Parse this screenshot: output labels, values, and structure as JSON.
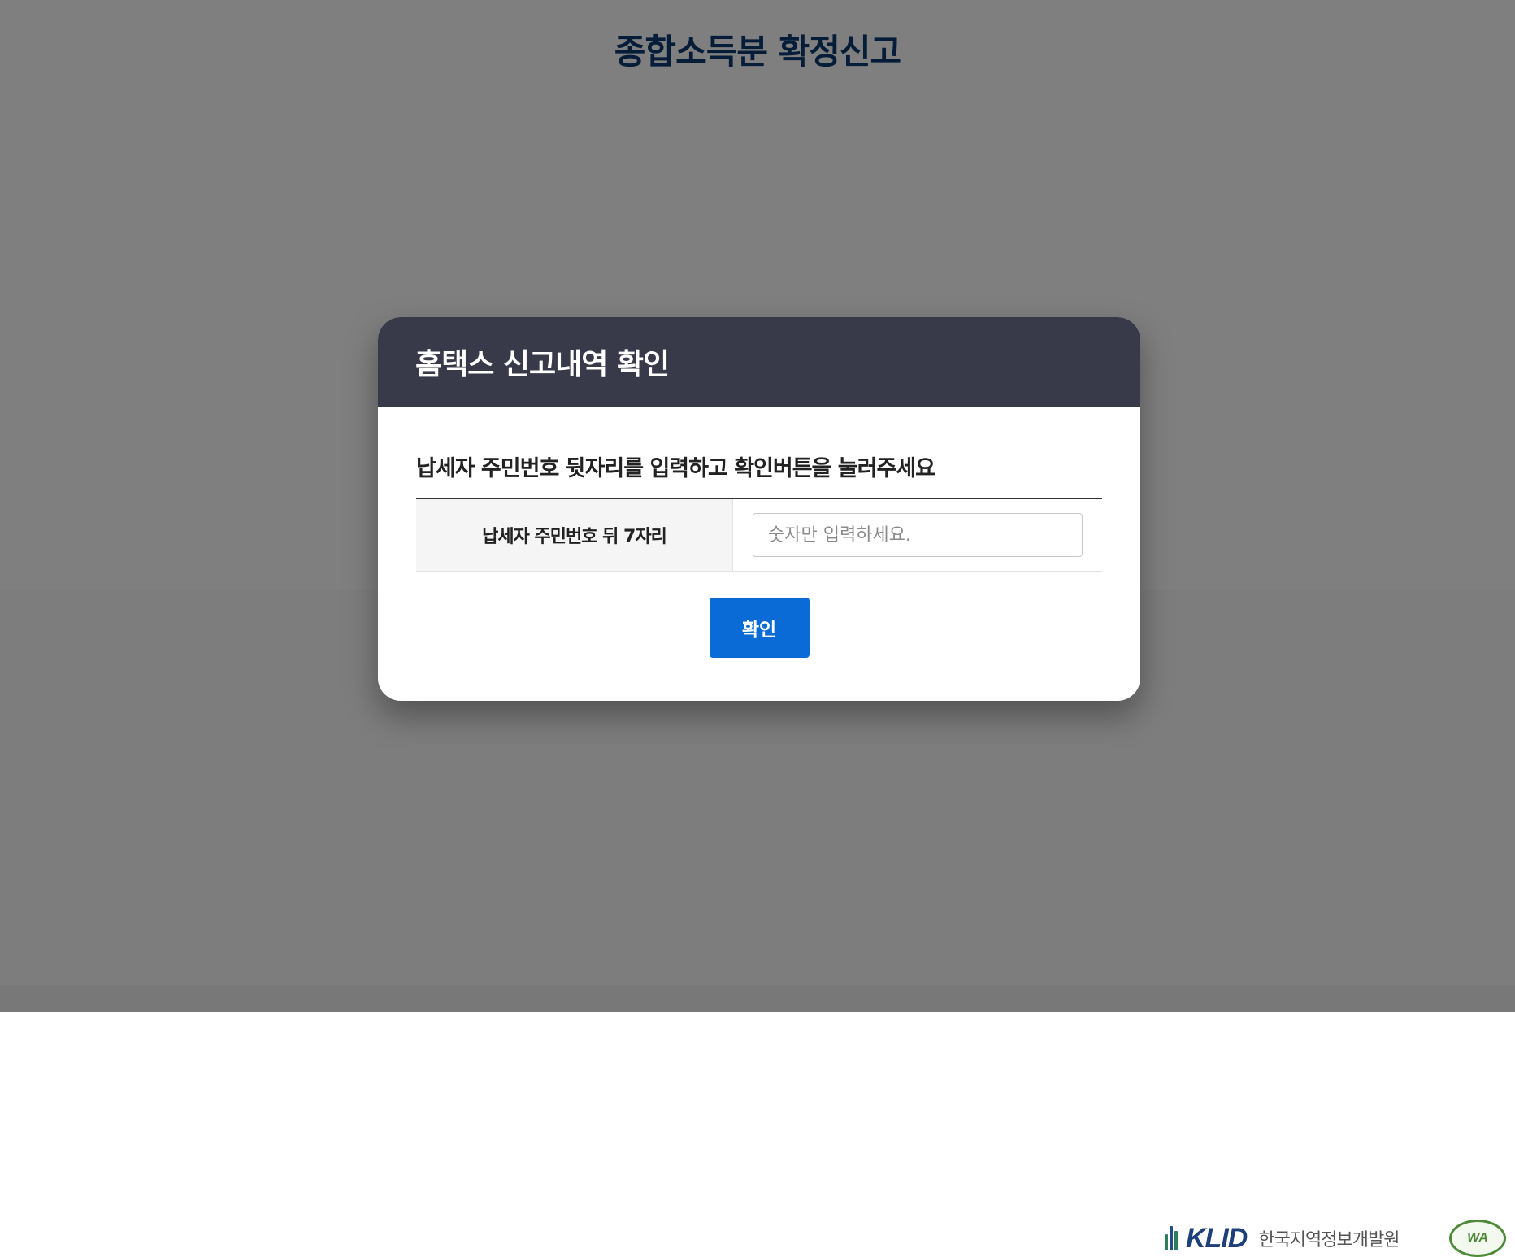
{
  "page": {
    "title": "종합소득분 확정신고"
  },
  "footer": {
    "klid_logo_text": "KLID",
    "klid_org_name": "한국지역정보개발원",
    "wa_logo_text": "WA"
  },
  "modal": {
    "title": "홈택스 신고내역 확인",
    "instruction": "납세자 주민번호 뒷자리를 입력하고 확인버튼을 눌러주세요",
    "field_label": "납세자 주민번호 뒤 7자리",
    "field_placeholder": "숫자만 입력하세요.",
    "field_value": "",
    "confirm_label": "확인"
  },
  "colors": {
    "header_bg": "#383a4a",
    "title_color": "#0b3a73",
    "primary_button": "#0a6ad6"
  }
}
